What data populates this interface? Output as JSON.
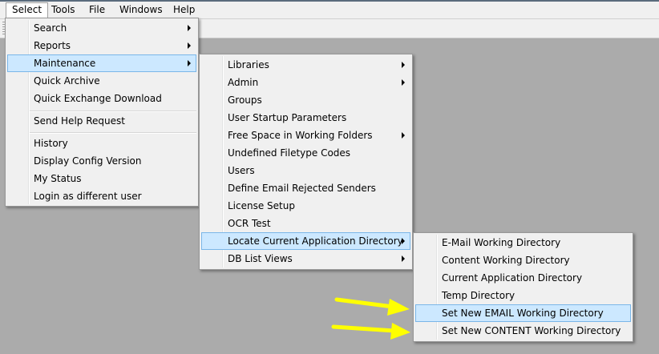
{
  "menubar": {
    "items": [
      {
        "label": "Select"
      },
      {
        "label": "Tools"
      },
      {
        "label": "File"
      },
      {
        "label": "Windows"
      },
      {
        "label": "Help"
      }
    ]
  },
  "select_menu": {
    "items": [
      {
        "label": "Search",
        "submenu": true
      },
      {
        "label": "Reports",
        "submenu": true
      },
      {
        "label": "Maintenance",
        "submenu": true,
        "highlighted": true
      },
      {
        "label": "Quick Archive"
      },
      {
        "label": "Quick Exchange Download"
      },
      {
        "label": "Send Help Request"
      },
      {
        "label": "History"
      },
      {
        "label": "Display Config Version"
      },
      {
        "label": "My Status"
      },
      {
        "label": "Login as different user"
      }
    ]
  },
  "maintenance_menu": {
    "items": [
      {
        "label": "Libraries",
        "submenu": true
      },
      {
        "label": "Admin",
        "submenu": true
      },
      {
        "label": "Groups"
      },
      {
        "label": "User Startup Parameters"
      },
      {
        "label": "Free Space in Working Folders",
        "submenu": true
      },
      {
        "label": "Undefined Filetype Codes"
      },
      {
        "label": "Users"
      },
      {
        "label": "Define Email Rejected Senders"
      },
      {
        "label": "License Setup"
      },
      {
        "label": "OCR Test"
      },
      {
        "label": "Locate Current Application Directory",
        "submenu": true,
        "highlighted": true
      },
      {
        "label": "DB List Views",
        "submenu": true
      }
    ]
  },
  "locate_menu": {
    "items": [
      {
        "label": "E-Mail Working Directory"
      },
      {
        "label": "Content Working Directory"
      },
      {
        "label": "Current Application Directory"
      },
      {
        "label": "Temp Directory"
      },
      {
        "label": "Set New EMAIL Working Directory",
        "highlighted": true
      },
      {
        "label": "Set New CONTENT Working Directory"
      }
    ]
  },
  "annotations": {
    "arrow_color": "#ffff00",
    "arrows": [
      "arrow-to-set-new-email",
      "arrow-to-set-new-content"
    ]
  },
  "colors": {
    "workspace": "#ababab",
    "menu_bg": "#f0f0f0",
    "highlight_bg": "#cce8ff",
    "highlight_border": "#7ab6e8"
  }
}
